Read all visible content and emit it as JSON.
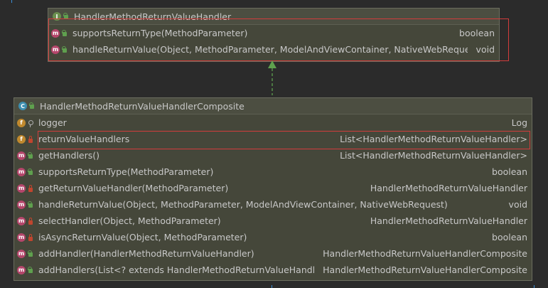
{
  "interface_box": {
    "title": "HandlerMethodReturnValueHandler",
    "icon": "I",
    "members": [
      {
        "icon": "m",
        "visibility": "public",
        "name": "supportsReturnType(MethodParameter)",
        "type": "boolean"
      },
      {
        "icon": "m",
        "visibility": "public",
        "name": "handleReturnValue(Object, MethodParameter, ModelAndViewContainer, NativeWebRequest)",
        "type": "void"
      }
    ]
  },
  "class_box": {
    "title": "HandlerMethodReturnValueHandlerComposite",
    "icon": "C",
    "members": [
      {
        "icon": "f",
        "visibility": "static",
        "name": "logger",
        "type": "Log"
      },
      {
        "icon": "f",
        "visibility": "private",
        "name": "returnValueHandlers",
        "type": "List<HandlerMethodReturnValueHandler>"
      },
      {
        "icon": "m",
        "visibility": "public",
        "name": "getHandlers()",
        "type": "List<HandlerMethodReturnValueHandler>"
      },
      {
        "icon": "m",
        "visibility": "public",
        "name": "supportsReturnType(MethodParameter)",
        "type": "boolean"
      },
      {
        "icon": "m",
        "visibility": "private",
        "name": "getReturnValueHandler(MethodParameter)",
        "type": "HandlerMethodReturnValueHandler"
      },
      {
        "icon": "m",
        "visibility": "public",
        "name": "handleReturnValue(Object, MethodParameter, ModelAndViewContainer, NativeWebRequest)",
        "type": "void"
      },
      {
        "icon": "m",
        "visibility": "private",
        "name": "selectHandler(Object, MethodParameter)",
        "type": "HandlerMethodReturnValueHandler"
      },
      {
        "icon": "m",
        "visibility": "private",
        "name": "isAsyncReturnValue(Object, MethodParameter)",
        "type": "boolean"
      },
      {
        "icon": "m",
        "visibility": "public",
        "name": "addHandler(HandlerMethodReturnValueHandler)",
        "type": "HandlerMethodReturnValueHandlerComposite"
      },
      {
        "icon": "m",
        "visibility": "public",
        "name": "addHandlers(List<? extends HandlerMethodReturnValueHandler>)",
        "type": "HandlerMethodReturnValueHandlerComposite"
      }
    ]
  },
  "colors": {
    "connector": "#5fa04e",
    "highlight": "#d23c3c"
  }
}
